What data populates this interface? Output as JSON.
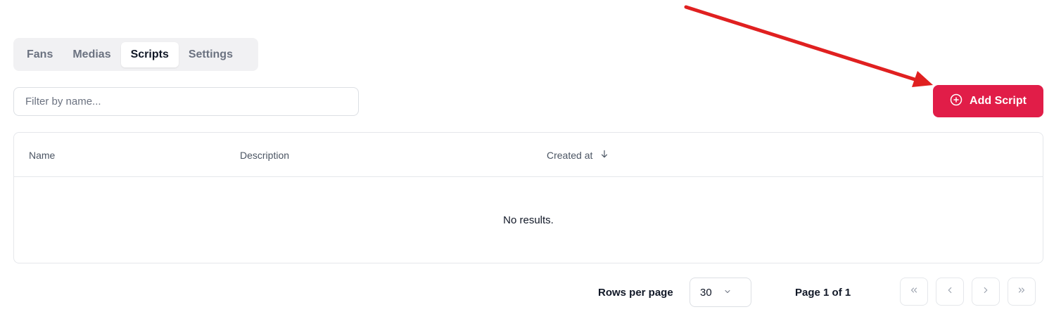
{
  "tabs": [
    {
      "label": "Fans",
      "active": false
    },
    {
      "label": "Medias",
      "active": false
    },
    {
      "label": "Scripts",
      "active": true
    },
    {
      "label": "Settings",
      "active": false
    }
  ],
  "filter": {
    "placeholder": "Filter by name...",
    "value": ""
  },
  "add_button": {
    "label": "Add Script",
    "icon": "plus-circle-icon"
  },
  "table": {
    "columns": [
      {
        "label": "Name"
      },
      {
        "label": "Description"
      },
      {
        "label": "Created at",
        "sort": "desc",
        "icon": "arrow-down-icon"
      }
    ],
    "rows": [],
    "empty_text": "No results."
  },
  "pagination": {
    "rows_per_page_label": "Rows per page",
    "rows_per_page_value": "30",
    "page_text": "Page 1 of 1"
  },
  "annotation": {
    "arrow_color": "#e02020"
  },
  "colors": {
    "accent": "#e11d48"
  }
}
